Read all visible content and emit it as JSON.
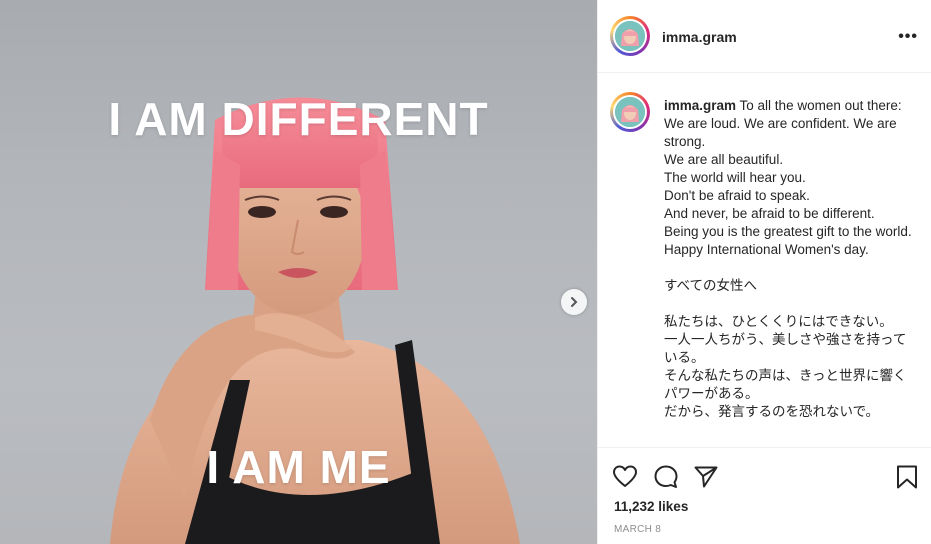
{
  "post": {
    "image": {
      "overlay_top": "I AM DIFFERENT",
      "overlay_bottom": "I AM ME"
    },
    "header": {
      "username": "imma.gram",
      "more_icon": "more-horizontal-icon"
    },
    "caption": {
      "username": "imma.gram",
      "text": " To all the women out there:\nWe are loud. We are confident. We are strong.\nWe are all beautiful.\nThe world will hear you.\nDon't be afraid to speak.\nAnd never, be afraid to be different.\nBeing you is the greatest gift to the world.\nHappy International Women's day.\n\nすべての女性へ\n\n私たちは、ひとくくりにはできない。\n一人一人ちがう、美しさや強さを持っている。\nそんな私たちの声は、きっと世界に響くパワーがある。\nだから、発言するのを恐れないで。"
    },
    "actions": {
      "like_icon": "heart-icon",
      "comment_icon": "comment-icon",
      "share_icon": "paper-plane-icon",
      "save_icon": "bookmark-icon"
    },
    "likes": "11,232 likes",
    "date": "MARCH 8"
  },
  "colors": {
    "accent": "#262626",
    "muted": "#8e8e8e",
    "divider": "#efefef",
    "hair": "#f0788a",
    "backdrop": "#b3b6bb"
  }
}
